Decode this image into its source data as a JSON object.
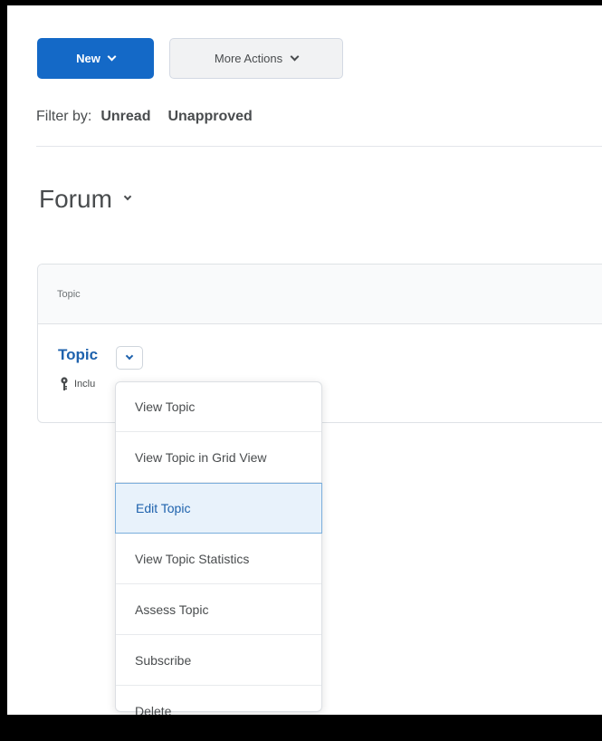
{
  "toolbar": {
    "new_label": "New",
    "more_actions_label": "More Actions"
  },
  "filter": {
    "label": "Filter by:",
    "options": [
      "Unread",
      "Unapproved"
    ]
  },
  "forum": {
    "title": "Forum"
  },
  "table": {
    "column_header": "Topic",
    "row": {
      "topic_link": "Topic",
      "include_text": "Inclu"
    }
  },
  "context_menu": {
    "items": [
      "View Topic",
      "View Topic in Grid View",
      "Edit Topic",
      "View Topic Statistics",
      "Assess Topic",
      "Subscribe",
      "Delete"
    ],
    "selected": "Edit Topic"
  },
  "colors": {
    "primary": "#1469c7",
    "link": "#1e62ad",
    "text": "#494c4e",
    "selected_bg": "#e8f2fb",
    "selected_border": "#7aaedc"
  },
  "icons": {
    "new_chevron": "chevron-down-icon",
    "more_chevron": "chevron-down-icon",
    "forum_chevron": "chevron-down-icon",
    "topic_chevron": "chevron-down-icon",
    "include_icon": "pin-icon"
  }
}
